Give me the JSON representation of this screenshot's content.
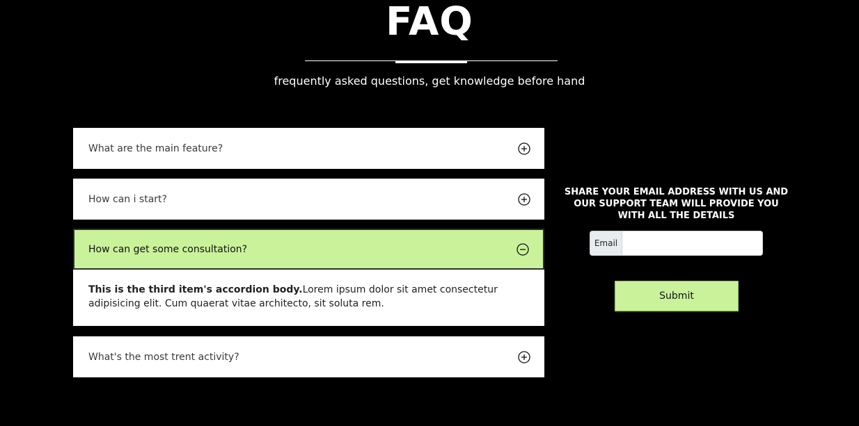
{
  "header": {
    "title": "FAQ",
    "subtitle": "frequently asked questions, get knowledge before hand"
  },
  "accordion": {
    "items": [
      {
        "question": "What are the main feature?",
        "expanded": false,
        "icon": "plus-circle-icon"
      },
      {
        "question": "How can i start?",
        "expanded": false,
        "icon": "plus-circle-icon"
      },
      {
        "question": "How can get some consultation?",
        "expanded": true,
        "icon": "minus-circle-icon",
        "body_strong": "This is the third item's accordion body.",
        "body_text": "Lorem ipsum dolor sit amet consectetur adipisicing elit. Cum quaerat vitae architecto, sit soluta rem."
      },
      {
        "question": "What's the most trent activity?",
        "expanded": false,
        "icon": "plus-circle-icon"
      }
    ]
  },
  "contact": {
    "heading": "Share your email address with us and our support team will provide you with all the details",
    "email_label": "Email",
    "email_value": "",
    "submit_label": "Submit"
  },
  "colors": {
    "background": "#000000",
    "accent": "#c9f29b",
    "text_light": "#ffffff"
  }
}
